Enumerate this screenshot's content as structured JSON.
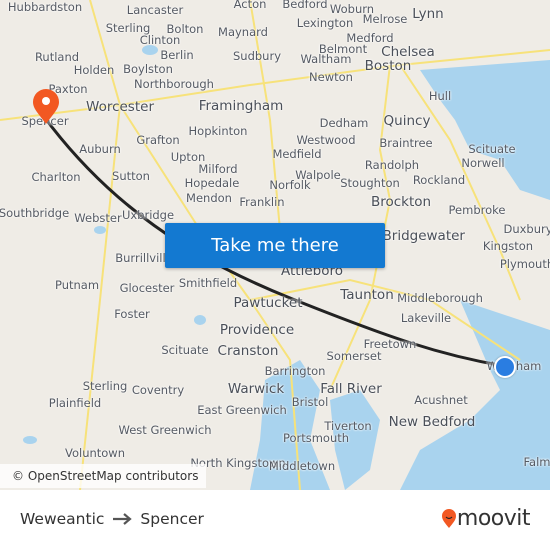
{
  "map": {
    "towns": [
      "Hubbardston",
      "Lancaster",
      "Acton",
      "Bedford",
      "Woburn",
      "Melrose",
      "Lynn",
      "Sterling",
      "Bolton",
      "Maynard",
      "Lexington",
      "Rutland",
      "Clinton",
      "Berlin",
      "Sudbury",
      "Medford",
      "Chelsea",
      "Holden",
      "Boylston",
      "Belmont",
      "Boston",
      "Paxton",
      "Northborough",
      "Waltham",
      "Newton",
      "Worcester",
      "Framingham",
      "Hull",
      "Spencer",
      "Hopkinton",
      "Dedham",
      "Quincy",
      "Auburn",
      "Grafton",
      "Westwood",
      "Braintree",
      "Scituate",
      "Upton",
      "Medfield",
      "Norwell",
      "Milford",
      "Randolph",
      "Charlton",
      "Sutton",
      "Hopedale",
      "Walpole",
      "Norfolk",
      "Stoughton",
      "Rockland",
      "Mendon",
      "Brockton",
      "Southbridge",
      "Webster",
      "Uxbridge",
      "Franklin",
      "Pembroke",
      "Duxbury",
      "West Bridgewater",
      "Kingston",
      "Plymouth",
      "Attleboro",
      "Burrillville",
      "Putnam",
      "Glocester",
      "Smithfield",
      "Taunton",
      "Middleborough",
      "Pawtucket",
      "Foster",
      "Providence",
      "Lakeville",
      "Freetown",
      "Scituate",
      "Cranston",
      "Somerset",
      "Wareham",
      "Barrington",
      "Sterling",
      "Coventry",
      "Warwick",
      "Fall River",
      "Bristol",
      "Acushnet",
      "Plainfield",
      "East Greenwich",
      "New Bedford",
      "West Greenwich",
      "Tiverton",
      "Portsmouth",
      "Voluntown",
      "North Kingstown",
      "Middletown",
      "Falm"
    ],
    "origin_marker_color": "#2a7de1",
    "destination_marker_color": "#f25822",
    "route_color": "#222222",
    "water_color": "#a9d3ee"
  },
  "cta": {
    "label": "Take me there",
    "color": "#1379d1"
  },
  "attribution": "© OpenStreetMap contributors",
  "footer": {
    "origin": "Weweantic",
    "destination": "Spencer",
    "arrow_icon": "arrow-right",
    "brand": "moovit",
    "brand_color": "#f25822"
  }
}
